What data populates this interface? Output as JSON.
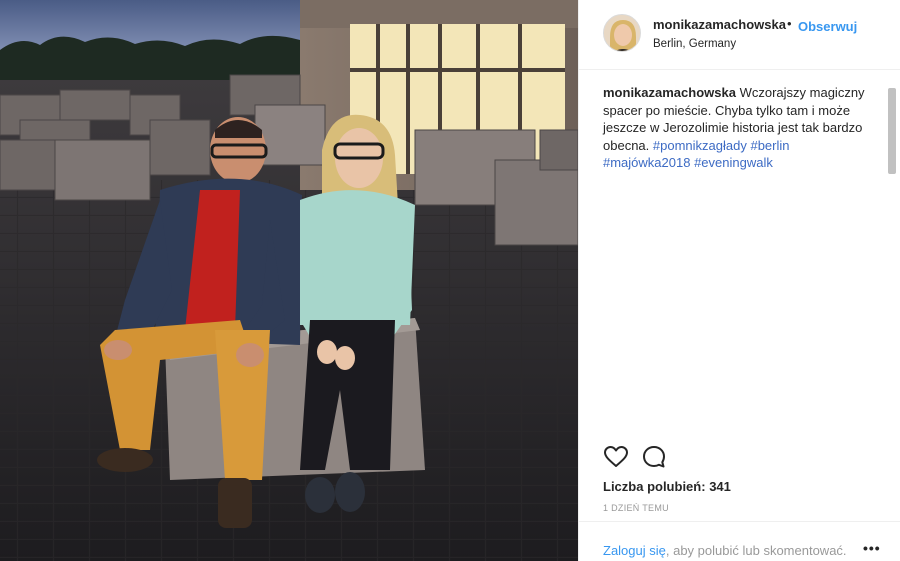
{
  "post": {
    "username": "monikazamachowska",
    "separator": "•",
    "follow_label": "Obserwuj",
    "location": "Berlin, Germany",
    "caption": {
      "username": "monikazamachowska",
      "text": "Wczorajszy magiczny spacer po mieście. Chyba tylko tam i może jeszcze w Jerozolimie historia jest tak bardzo obecna.",
      "tags": [
        "#pomnikzagłady",
        "#berlin",
        "#majówka2018",
        "#eveningwalk"
      ]
    },
    "likes_label": "Liczba polubień:",
    "likes_count": "341",
    "time_label": "1 DZIEŃ TEMU",
    "login_link": "Zaloguj się",
    "login_rest": ", aby polubić lub skomentować.",
    "more_label": "•••"
  },
  "icons": {
    "like": "heart-outline-icon",
    "comment": "speech-bubble-icon",
    "more": "ellipsis-icon"
  },
  "colors": {
    "link": "#3897f0",
    "hashtag": "#3d6bc4",
    "muted": "#999999",
    "text": "#262626"
  }
}
